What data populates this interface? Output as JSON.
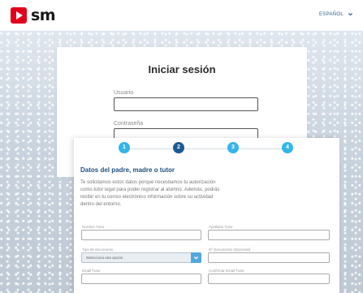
{
  "brand": {
    "logo_text": "sm"
  },
  "header": {
    "language_label": "ESPAÑOL"
  },
  "login": {
    "title": "Iniciar sesión",
    "username_label": "Usuario",
    "username_value": "",
    "password_label": "Contraseña",
    "password_value": ""
  },
  "stepper": {
    "steps": [
      {
        "number": "1",
        "state": "inactive"
      },
      {
        "number": "2",
        "state": "active"
      },
      {
        "number": "3",
        "state": "inactive"
      },
      {
        "number": "4",
        "state": "inactive"
      }
    ]
  },
  "registration": {
    "title": "Datos del padre, madre o tutor",
    "description": "Te solicitamos estos datos porque necesitamos tu autorización como tutor legal para poder registrar al alumno. Además, podrás recibir en tu correo electrónico información sobre su actividad dentro del entorno.",
    "fields": {
      "tutor_name_label": "Nombre Tutor",
      "tutor_surname_label": "Apellidos Tutor",
      "document_type_label": "Tipo de documento",
      "document_type_value": "Selecciona una opción",
      "document_number_label": "Nº Documento (Opcional)",
      "tutor_email_label": "Email Tutor",
      "confirm_email_label": "Confirmar Email Tutor"
    }
  },
  "colors": {
    "brand_red": "#e2001a",
    "step_active": "#1b5b8f",
    "step_inactive": "#35b5e8",
    "title_blue": "#1f4f7f",
    "select_button": "#4fa8dc"
  }
}
